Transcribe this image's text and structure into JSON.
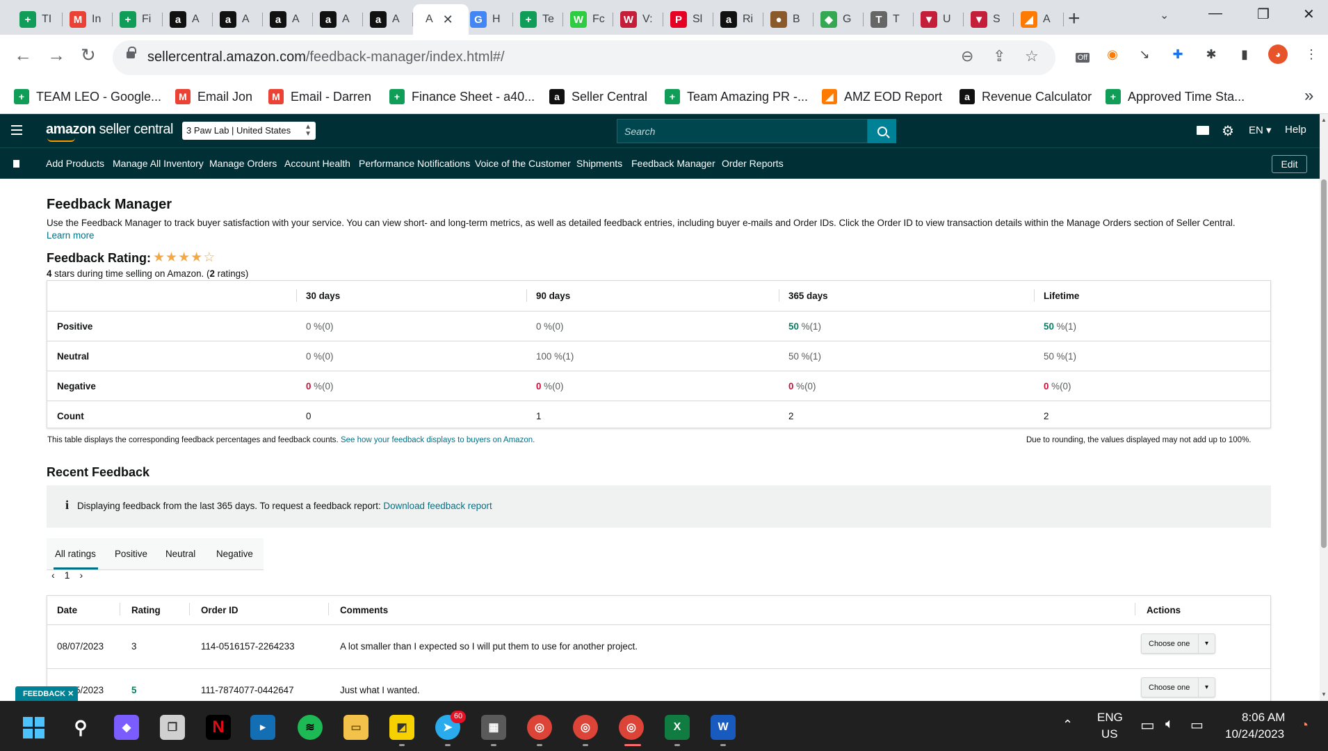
{
  "browser": {
    "tabs": [
      {
        "icon": "google-sheets-icon",
        "glyph": "+",
        "color": "#0f9d58",
        "label": "TI"
      },
      {
        "icon": "gmail-icon",
        "glyph": "M",
        "color": "#ea4335",
        "label": "In"
      },
      {
        "icon": "google-sheets-icon",
        "glyph": "+",
        "color": "#0f9d58",
        "label": "Fi"
      },
      {
        "icon": "amazon-icon",
        "glyph": "a",
        "color": "#111111",
        "label": "A"
      },
      {
        "icon": "amazon-icon",
        "glyph": "a",
        "color": "#111111",
        "label": "A"
      },
      {
        "icon": "amazon-icon",
        "glyph": "a",
        "color": "#111111",
        "label": "A"
      },
      {
        "icon": "amazon-icon",
        "glyph": "a",
        "color": "#111111",
        "label": "A"
      },
      {
        "icon": "amazon-icon",
        "glyph": "a",
        "color": "#111111",
        "label": "A"
      },
      {
        "icon": "amazon-icon",
        "glyph": "",
        "color": "#ffffff",
        "label": "A"
      },
      {
        "icon": "google-icon",
        "glyph": "G",
        "color": "#4285f4",
        "label": "H"
      },
      {
        "icon": "google-sheets-icon",
        "glyph": "+",
        "color": "#0f9d58",
        "label": "Te"
      },
      {
        "icon": "w-green-icon",
        "glyph": "W",
        "color": "#2ecc40",
        "label": "Fc"
      },
      {
        "icon": "wv-icon",
        "glyph": "W",
        "color": "#c41e3a",
        "label": "V:"
      },
      {
        "icon": "pinterest-icon",
        "glyph": "P",
        "color": "#e60023",
        "label": "Sl"
      },
      {
        "icon": "amazon-icon",
        "glyph": "a",
        "color": "#111111",
        "label": "Ri"
      },
      {
        "icon": "cookie-icon",
        "glyph": "●",
        "color": "#8b5a2b",
        "label": "B"
      },
      {
        "icon": "google-maps-icon",
        "glyph": "◆",
        "color": "#34a853",
        "label": "G"
      },
      {
        "icon": "t-icon",
        "glyph": "T",
        "color": "#666666",
        "label": "T"
      },
      {
        "icon": "v-red-icon",
        "glyph": "▼",
        "color": "#c41e3a",
        "label": "U"
      },
      {
        "icon": "v-red-icon",
        "glyph": "▼",
        "color": "#c41e3a",
        "label": "S"
      },
      {
        "icon": "colorful-icon",
        "glyph": "◢",
        "color": "#ff7a00",
        "label": "A"
      }
    ],
    "url_domain": "sellercentral.amazon.com",
    "url_path": "/feedback-manager/index.html#/",
    "bookmarks": [
      {
        "icon": "google-sheets-icon",
        "glyph": "+",
        "color": "#0f9d58",
        "label": "TEAM LEO - Google..."
      },
      {
        "icon": "gmail-icon",
        "glyph": "M",
        "color": "#ea4335",
        "label": "Email Jon"
      },
      {
        "icon": "gmail-icon",
        "glyph": "M",
        "color": "#ea4335",
        "label": "Email - Darren"
      },
      {
        "icon": "google-sheets-icon",
        "glyph": "+",
        "color": "#0f9d58",
        "label": "Finance Sheet - a40..."
      },
      {
        "icon": "amazon-icon",
        "glyph": "a",
        "color": "#111111",
        "label": "Seller Central"
      },
      {
        "icon": "google-sheets-icon",
        "glyph": "+",
        "color": "#0f9d58",
        "label": "Team Amazing PR -..."
      },
      {
        "icon": "colorful-icon",
        "glyph": "◢",
        "color": "#ff7a00",
        "label": "AMZ EOD Report"
      },
      {
        "icon": "amazon-icon",
        "glyph": "a",
        "color": "#111111",
        "label": "Revenue Calculator"
      },
      {
        "icon": "google-sheets-icon",
        "glyph": "+",
        "color": "#0f9d58",
        "label": "Approved Time Sta..."
      }
    ],
    "ext_off_label": "Off"
  },
  "header": {
    "logo_a": "amazon",
    "logo_b": " seller central",
    "account": "3 Paw Lab | United States",
    "search_placeholder": "Search",
    "lang": "EN ▾",
    "help": "Help"
  },
  "nav": {
    "links": [
      "Add Products",
      "Manage All Inventory",
      "Manage Orders",
      "Account Health",
      "Performance Notifications",
      "Voice of the Customer",
      "Shipments",
      "Feedback Manager",
      "Order Reports"
    ],
    "edit": "Edit"
  },
  "page": {
    "title": "Feedback Manager",
    "description": "Use the Feedback Manager to track buyer satisfaction with your service. You can view short- and long-term metrics, as well as detailed feedback entries, including buyer e-mails and Order IDs. Click the Order ID to view transaction details within the Manage Orders section of Seller Central.",
    "learn_more": "Learn more",
    "rating_label": "Feedback Rating:",
    "rating_stars": 4,
    "rating_max": 5,
    "rating_value": "4",
    "rating_text_a": " stars during time selling on Amazon. (",
    "rating_count": "2",
    "rating_text_b": " ratings)"
  },
  "metrics": {
    "columns": [
      "30 days",
      "90 days",
      "365 days",
      "Lifetime"
    ],
    "rows": [
      {
        "label": "Positive",
        "kind": "pos",
        "cells": [
          {
            "n": "0",
            "r": " %(0)"
          },
          {
            "n": "0",
            "r": " %(0)"
          },
          {
            "n": "50",
            "r": " %(1)"
          },
          {
            "n": "50",
            "r": " %(1)"
          }
        ]
      },
      {
        "label": "Neutral",
        "kind": "neu",
        "cells": [
          {
            "n": "0",
            "r": " %(0)"
          },
          {
            "n": "100",
            "r": " %(1)"
          },
          {
            "n": "50",
            "r": " %(1)"
          },
          {
            "n": "50",
            "r": " %(1)"
          }
        ]
      },
      {
        "label": "Negative",
        "kind": "neg",
        "cells": [
          {
            "n": "0",
            "r": " %(0)"
          },
          {
            "n": "0",
            "r": " %(0)"
          },
          {
            "n": "0",
            "r": " %(0)"
          },
          {
            "n": "0",
            "r": " %(0)"
          }
        ]
      },
      {
        "label": "Count",
        "kind": "count",
        "cells": [
          {
            "n": "0",
            "r": ""
          },
          {
            "n": "1",
            "r": ""
          },
          {
            "n": "2",
            "r": ""
          },
          {
            "n": "2",
            "r": ""
          }
        ]
      }
    ],
    "note_left": "This table displays the corresponding feedback percentages and feedback counts.",
    "note_link": "See how your feedback displays to buyers on Amazon.",
    "note_right": "Due to rounding, the values displayed may not add up to 100%."
  },
  "recent": {
    "title": "Recent Feedback",
    "info_icon": "i",
    "info_text": "Displaying feedback from the last 365 days. To request a feedback report:",
    "info_link": "Download feedback report",
    "tabs": [
      "All ratings",
      "Positive",
      "Neutral",
      "Negative"
    ],
    "page_prev": "‹",
    "page_num": "1",
    "page_next": "›",
    "columns": [
      "Date",
      "Rating",
      "Order ID",
      "Comments",
      "Actions"
    ],
    "rows": [
      {
        "date": "08/07/2023",
        "rating": "3",
        "order": "114-0516157-2264233",
        "comment": "A lot smaller than I expected so I will put them to use for another project.",
        "action": "Choose one"
      },
      {
        "date": "07/15/2023",
        "rating": "5",
        "order": "111-7874077-0442647",
        "comment": "Just what I wanted.",
        "action": "Choose one"
      }
    ],
    "feedback_badge": "FEEDBACK ✕"
  },
  "taskbar": {
    "telegram_badge": "60",
    "lang_top": "ENG",
    "lang_bottom": "US",
    "time": "8:06 AM",
    "date": "10/24/2023"
  }
}
